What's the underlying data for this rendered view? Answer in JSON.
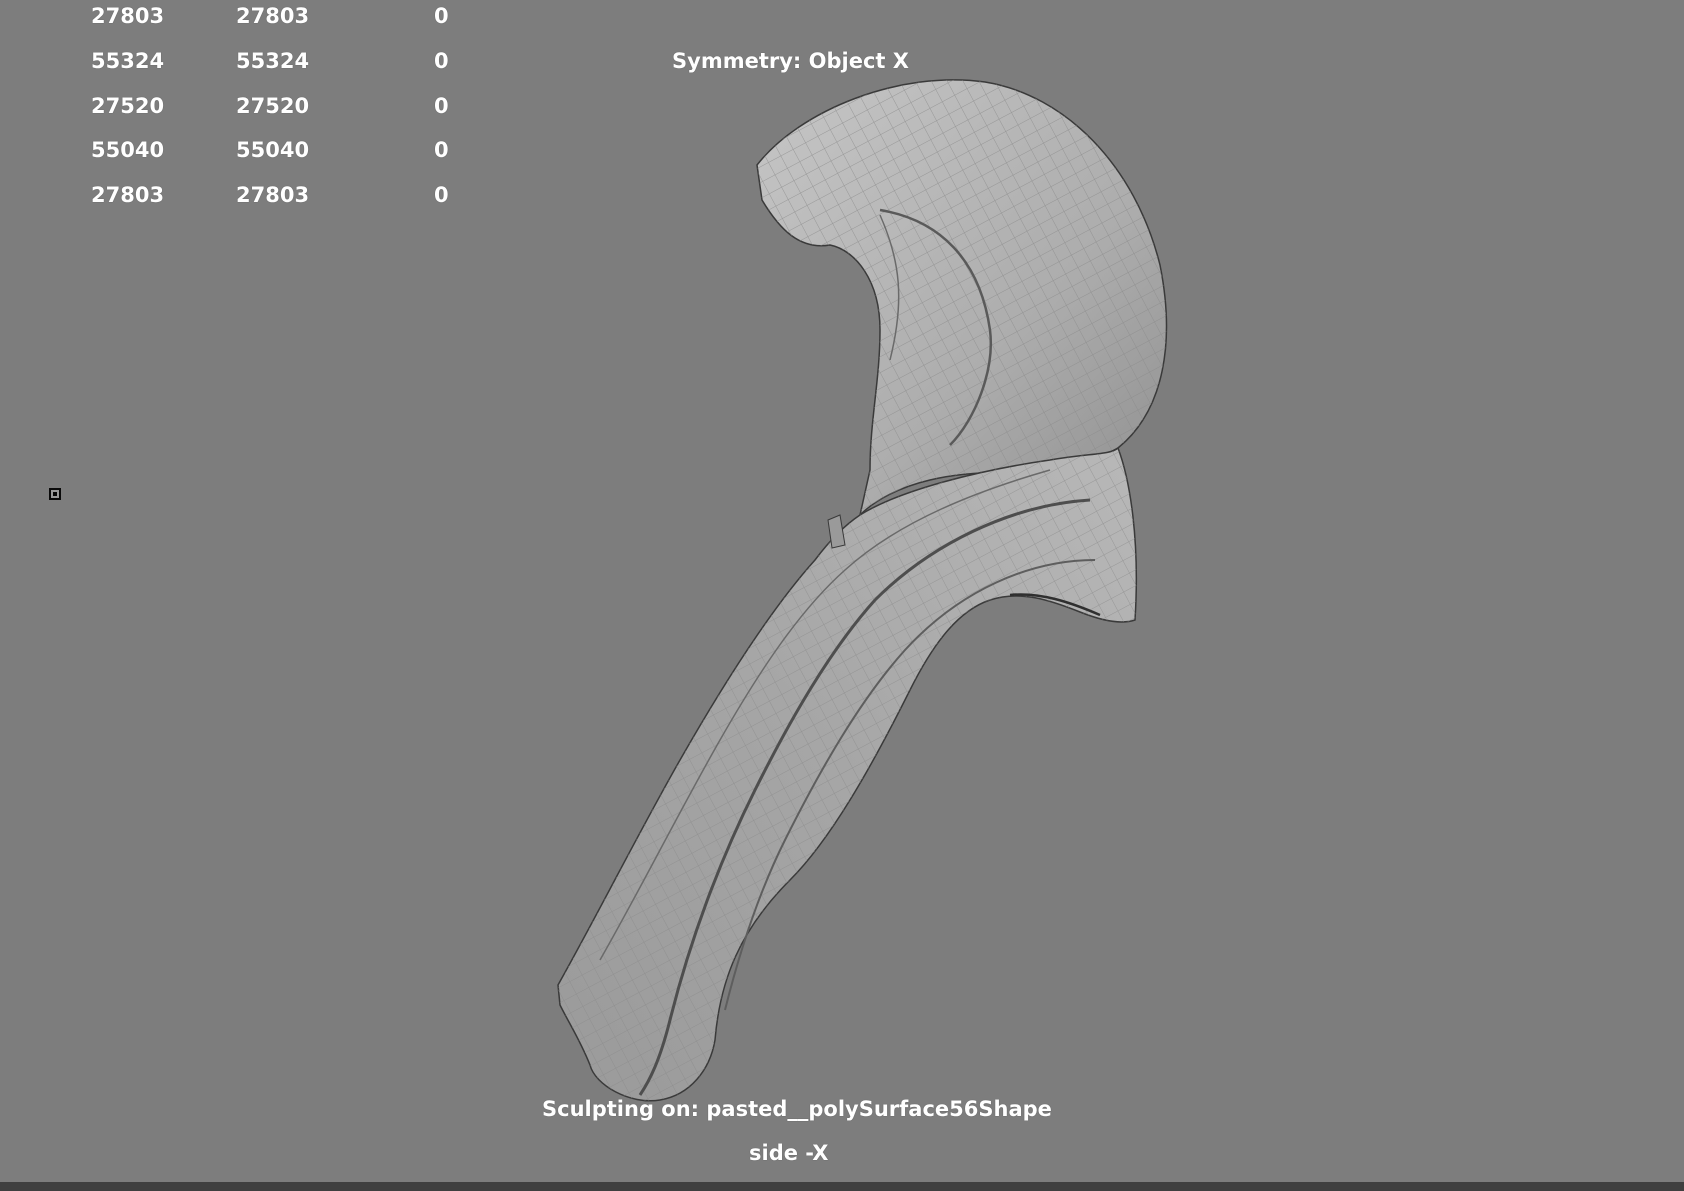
{
  "poly_count": {
    "rows": [
      [
        "27803",
        "27803",
        "0"
      ],
      [
        "55324",
        "55324",
        "0"
      ],
      [
        "27520",
        "27520",
        "0"
      ],
      [
        "55040",
        "55040",
        "0"
      ],
      [
        "27803",
        "27803",
        "0"
      ]
    ]
  },
  "viewport": {
    "symmetry_label": "Symmetry: Object X",
    "sculpting_label": "Sculpting on: pasted__polySurface56Shape",
    "camera_label": "side -X",
    "background_color": "#7d7d7d",
    "mesh_color": "#b4b4b4",
    "wire_color": "#7a7a7a"
  },
  "icons": {
    "pivot": "pivot-marker-icon"
  }
}
